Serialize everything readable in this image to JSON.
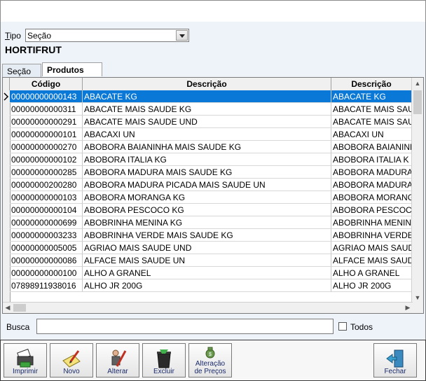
{
  "header": {
    "tipo_label": "Tipo",
    "tipo_value": "Seção",
    "section_name": "HORTIFRUT"
  },
  "tabs": [
    {
      "label": "Seção",
      "active": false
    },
    {
      "label": "Produtos",
      "active": true
    }
  ],
  "grid": {
    "columns": [
      "Código",
      "Descrição",
      "Descrição"
    ],
    "rows": [
      {
        "codigo": "00000000000143",
        "descricao": "ABACATE KG",
        "descricao2": "ABACATE KG"
      },
      {
        "codigo": "00000000000311",
        "descricao": "ABACATE MAIS SAUDE KG",
        "descricao2": "ABACATE MAIS SAU"
      },
      {
        "codigo": "00000000000291",
        "descricao": "ABACATE MAIS SAUDE UND",
        "descricao2": "ABACATE MAIS SAU"
      },
      {
        "codigo": "00000000000101",
        "descricao": "ABACAXI UN",
        "descricao2": "ABACAXI UN"
      },
      {
        "codigo": "00000000000270",
        "descricao": "ABOBORA BAIANINHA MAIS SAUDE KG",
        "descricao2": "ABOBORA BAIANINH"
      },
      {
        "codigo": "00000000000102",
        "descricao": "ABOBORA ITALIA KG",
        "descricao2": "ABOBORA ITALIA K"
      },
      {
        "codigo": "00000000000285",
        "descricao": "ABOBORA MADURA MAIS SAUDE KG",
        "descricao2": "ABOBORA MADURA I"
      },
      {
        "codigo": "00000000200280",
        "descricao": "ABOBORA MADURA PICADA MAIS SAUDE UN",
        "descricao2": "ABOBORA MADURA I"
      },
      {
        "codigo": "00000000000103",
        "descricao": "ABOBORA MORANGA KG",
        "descricao2": "ABOBORA MORANGA"
      },
      {
        "codigo": "00000000000104",
        "descricao": "ABOBORA PESCOCO KG",
        "descricao2": "ABOBORA PESCOCO"
      },
      {
        "codigo": "00000000000699",
        "descricao": "ABOBRINHA MENINA KG",
        "descricao2": "ABOBRINHA MENINA"
      },
      {
        "codigo": "00000000003233",
        "descricao": "ABOBRINHA VERDE MAIS SAUDE KG",
        "descricao2": "ABOBRINHA VERDE I"
      },
      {
        "codigo": "00000000005005",
        "descricao": "AGRIAO MAIS SAUDE UND",
        "descricao2": "AGRIAO MAIS SAUDI"
      },
      {
        "codigo": "00000000000086",
        "descricao": "ALFACE MAIS SAUDE UN",
        "descricao2": "ALFACE MAIS SAUD"
      },
      {
        "codigo": "00000000000100",
        "descricao": "ALHO A GRANEL",
        "descricao2": "ALHO A GRANEL"
      },
      {
        "codigo": "07898911938016",
        "descricao": "ALHO JR 200G",
        "descricao2": "ALHO JR 200G"
      }
    ],
    "selected_row": 0
  },
  "search": {
    "label": "Busca",
    "value": "",
    "todos_label": "Todos",
    "todos_checked": false
  },
  "toolbar": {
    "imprimir": "Imprimir",
    "novo": "Novo",
    "alterar": "Alterar",
    "excluir": "Excluir",
    "alteracao_1": "Alteração",
    "alteracao_2": "de Preços",
    "fechar": "Fechar"
  }
}
